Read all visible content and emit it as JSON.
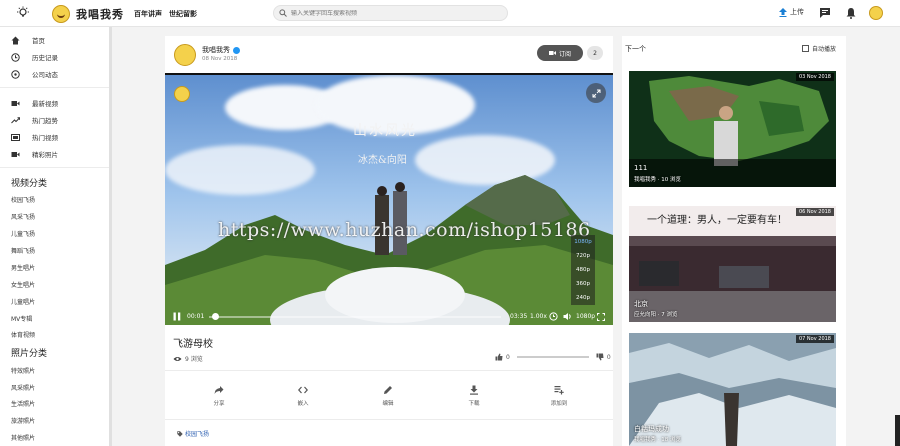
{
  "header": {
    "site_name": "我唱我秀",
    "slogan": "百年讲声　世纪留影",
    "search_placeholder": "输入关键字回车搜索视频",
    "upload_label": "上传"
  },
  "sidebar": {
    "nav": [
      {
        "label": "首页",
        "icon": "home-icon"
      },
      {
        "label": "历史记录",
        "icon": "history-icon"
      },
      {
        "label": "公司动态",
        "icon": "news-icon"
      }
    ],
    "nav2": [
      {
        "label": "最新视频",
        "icon": "video-icon"
      },
      {
        "label": "热门趋势",
        "icon": "trending-icon"
      },
      {
        "label": "热门视频",
        "icon": "hot-video-icon"
      },
      {
        "label": "精彩照片",
        "icon": "photo-icon"
      }
    ],
    "video_section": "视频分类",
    "video_cats": [
      "校园飞扬",
      "风采飞扬",
      "儿童飞扬",
      "舞蹈飞扬",
      "男生唱片",
      "女生唱片",
      "儿童唱片",
      "MV专辑",
      "体育视频"
    ],
    "photo_section": "照片分类",
    "photo_cats": [
      "特效照片",
      "风采照片",
      "生活照片",
      "旅游照片",
      "其他照片"
    ]
  },
  "video": {
    "channel_name": "我唱我秀",
    "channel_date": "08 Nov 2018",
    "follow_label": "订阅",
    "follow_count": "2",
    "overlay_title": "山水风光",
    "overlay_sub": "冰杰&向阳",
    "watermark": "https://www.huzhan.com/ishop15186",
    "current_time": "00:01",
    "duration": "03:35",
    "speed": "1.00x",
    "quality": "1080p",
    "quality_options": [
      "1080p",
      "720p",
      "480p",
      "360p",
      "240p"
    ],
    "progress": 0.01,
    "title": "飞游母校",
    "views": "9 浏览",
    "likes": "0",
    "dislikes": "0",
    "actions": [
      "分享",
      "嵌入",
      "编辑",
      "下载",
      "添加到"
    ],
    "tag": "校园飞扬"
  },
  "up_next": {
    "title": "下一个",
    "autoplay_label": "自动播放",
    "items": [
      {
        "date": "03 Nov 2018",
        "title": "111",
        "meta": "我唱我秀 · 10 浏览"
      },
      {
        "date": "06 Nov 2018",
        "title": "北京",
        "meta": "应允向阳 · 7 浏览",
        "overlay": "一个道理：男人，一定要有车！"
      },
      {
        "date": "07 Nov 2018",
        "title": "白钴玛成功",
        "meta": "我唱我秀 · 18 浏览"
      }
    ]
  }
}
